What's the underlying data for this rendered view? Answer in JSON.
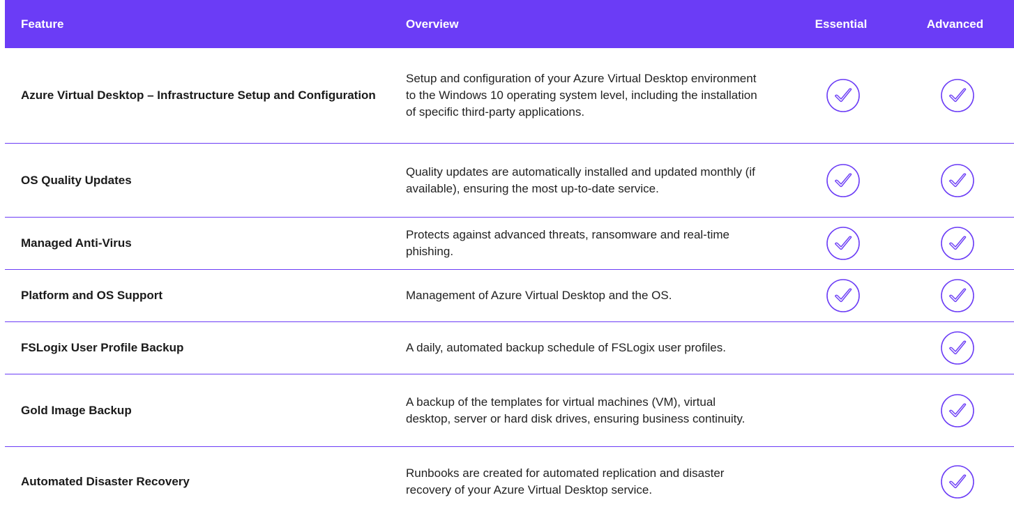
{
  "header": {
    "feature": "Feature",
    "overview": "Overview",
    "essential": "Essential",
    "advanced": "Advanced"
  },
  "colors": {
    "accent": "#6b3cf6"
  },
  "rows": [
    {
      "feature": "Azure Virtual Desktop – Infrastructure Setup and Configuration",
      "overview": "Setup and configuration of your Azure Virtual Desktop environment to the Windows 10 operating system level, including the installation of specific third-party applications.",
      "essential": true,
      "advanced": true
    },
    {
      "feature": "OS Quality Updates",
      "overview": "Quality updates are automatically installed and updated monthly (if available), ensuring the most up-to-date service.",
      "essential": true,
      "advanced": true
    },
    {
      "feature": "Managed Anti-Virus",
      "overview": "Protects against advanced threats, ransomware and real-time phishing.",
      "essential": true,
      "advanced": true
    },
    {
      "feature": "Platform and OS Support",
      "overview": "Management of Azure Virtual Desktop and the OS.",
      "essential": true,
      "advanced": true
    },
    {
      "feature": "FSLogix User Profile Backup",
      "overview": "A daily, automated backup schedule of FSLogix user profiles.",
      "essential": false,
      "advanced": true
    },
    {
      "feature": "Gold Image Backup",
      "overview": "A backup of the templates for virtual machines (VM), virtual desktop, server or hard disk drives, ensuring business continuity.",
      "essential": false,
      "advanced": true
    },
    {
      "feature": "Automated Disaster Recovery",
      "overview": "Runbooks are created for automated replication and disaster recovery of your Azure Virtual Desktop service.",
      "essential": false,
      "advanced": true
    }
  ]
}
